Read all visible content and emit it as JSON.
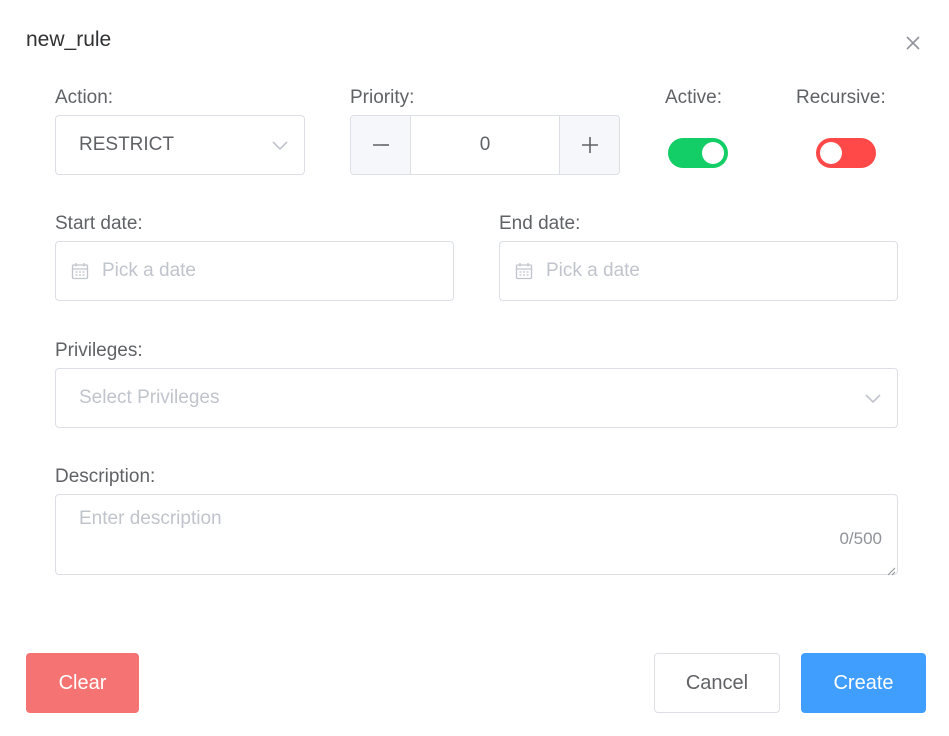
{
  "dialog": {
    "title": "new_rule"
  },
  "action": {
    "label": "Action:",
    "value": "RESTRICT"
  },
  "priority": {
    "label": "Priority:",
    "value": "0"
  },
  "active": {
    "label": "Active:",
    "on": true,
    "color": "#13ce66"
  },
  "recursive": {
    "label": "Recursive:",
    "on": false,
    "color": "#ff4949"
  },
  "start_date": {
    "label": "Start date:",
    "placeholder": "Pick a date"
  },
  "end_date": {
    "label": "End date:",
    "placeholder": "Pick a date"
  },
  "privileges": {
    "label": "Privileges:",
    "placeholder": "Select Privileges"
  },
  "description": {
    "label": "Description:",
    "placeholder": "Enter description",
    "counter": "0/500"
  },
  "footer": {
    "clear_label": "Clear",
    "cancel_label": "Cancel",
    "create_label": "Create"
  },
  "icons": {
    "close": "close-icon",
    "dropdown": "chevron-down-icon",
    "calendar": "calendar-icon",
    "minus": "minus-icon",
    "plus": "plus-icon"
  },
  "colors": {
    "primary": "#409eff",
    "danger": "#f56c6c",
    "success": "#13ce66"
  }
}
